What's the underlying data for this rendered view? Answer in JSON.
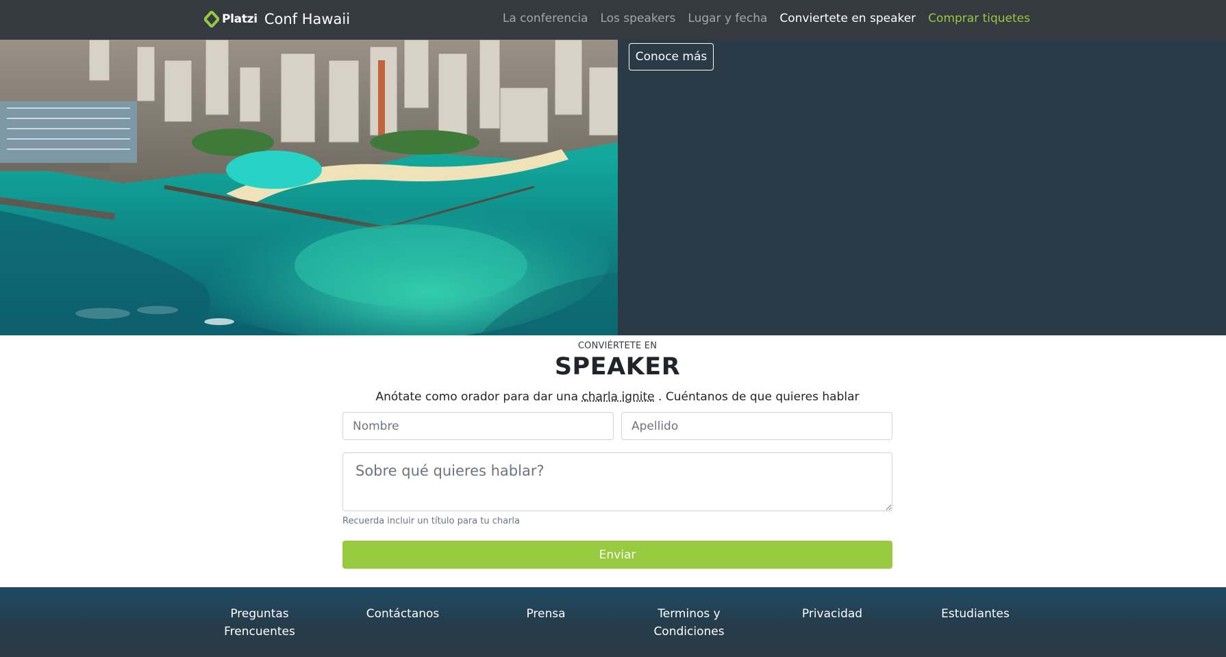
{
  "navbar": {
    "logo_text": "Platzi",
    "brand_name": "Conf Hawaii",
    "links": [
      {
        "label": "La conferencia"
      },
      {
        "label": "Los speakers"
      },
      {
        "label": "Lugar y fecha"
      },
      {
        "label": "Conviertete en speaker"
      },
      {
        "label": "Comprar tiquetes"
      }
    ]
  },
  "hero": {
    "button_label": "Conoce más"
  },
  "speaker_form": {
    "kicker": "CONVIÉRTETE EN",
    "heading": "SPEAKER",
    "subtitle_before": "Anótate como orador para dar una ",
    "subtitle_abbr": "charla ignite",
    "subtitle_after": " . Cuéntanos de que quieres hablar",
    "first_name_placeholder": "Nombre",
    "last_name_placeholder": "Apellido",
    "topic_placeholder": "Sobre qué quieres hablar?",
    "help_text": "Recuerda incluir un título para tu charla",
    "submit_label": "Enviar"
  },
  "footer": {
    "links": [
      {
        "line1": "Preguntas",
        "line2": "Frencuentes"
      },
      {
        "line1": "Contáctanos",
        "line2": ""
      },
      {
        "line1": "Prensa",
        "line2": ""
      },
      {
        "line1": "Terminos y",
        "line2": "Condiciones"
      },
      {
        "line1": "Privacidad",
        "line2": ""
      },
      {
        "line1": "Estudiantes",
        "line2": ""
      }
    ]
  },
  "colors": {
    "navbar_bg": "#343a40",
    "hero_bg": "#2a3b47",
    "accent_green": "#98ca3f",
    "footer_bg": "#1f4a66"
  },
  "icons": {
    "logo": "platzi-logo-icon"
  }
}
